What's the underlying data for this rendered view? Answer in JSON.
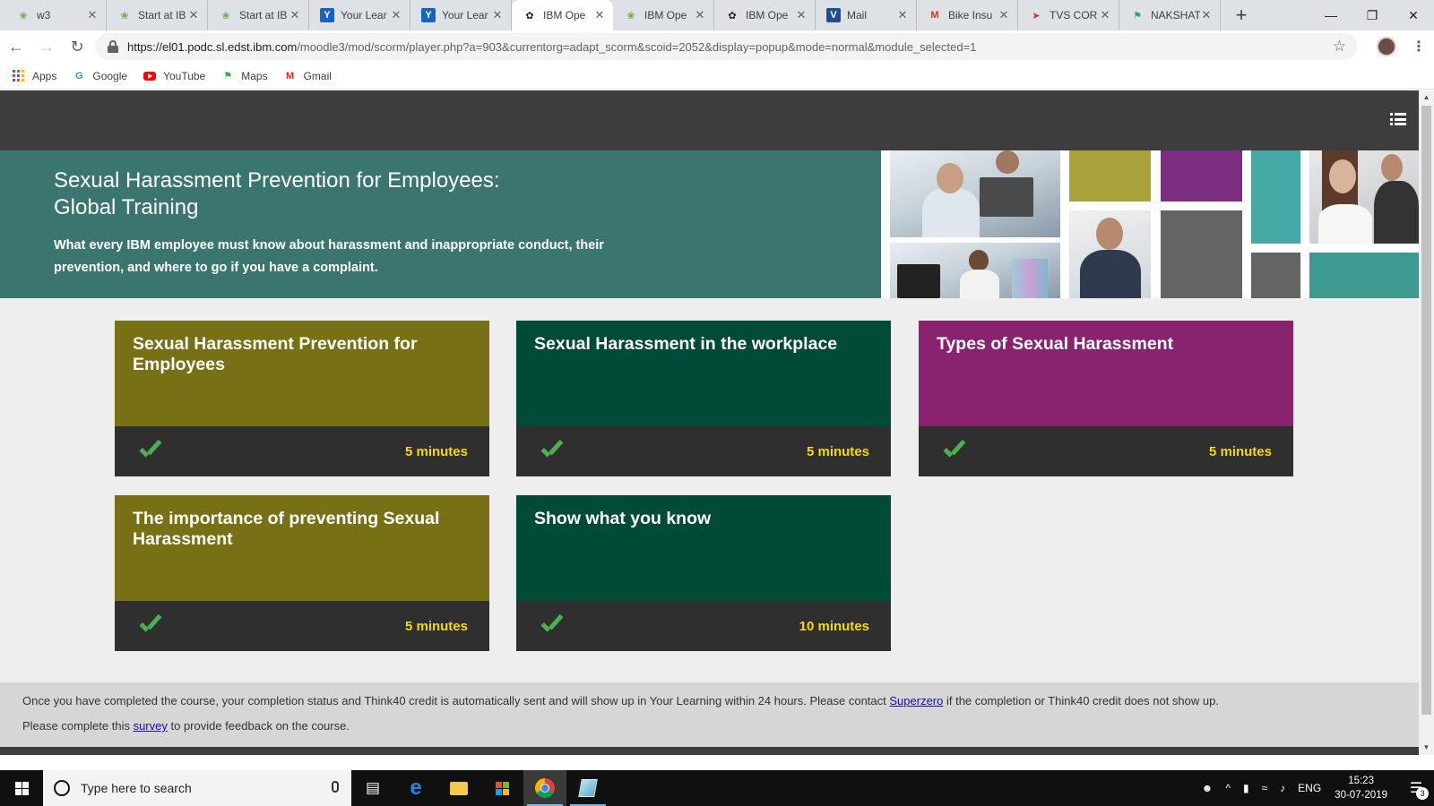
{
  "browser": {
    "tabs": [
      {
        "title": "w3",
        "icon": "ibm-bee-icon",
        "active": false
      },
      {
        "title": "Start at IB",
        "icon": "ibm-bee-icon",
        "active": false
      },
      {
        "title": "Start at IB",
        "icon": "ibm-bee-icon",
        "active": false
      },
      {
        "title": "Your Lear",
        "icon": "yl-icon",
        "active": false
      },
      {
        "title": "Your Lear",
        "icon": "yl-icon",
        "active": false
      },
      {
        "title": "IBM Ope",
        "icon": "ibm-icon",
        "active": true
      },
      {
        "title": "IBM Ope",
        "icon": "ibm-bee-icon",
        "active": false
      },
      {
        "title": "IBM Ope",
        "icon": "ibm-icon",
        "active": false
      },
      {
        "title": "Mail",
        "icon": "verse-icon",
        "active": false
      },
      {
        "title": "Bike Insu",
        "icon": "gmail-icon",
        "active": false
      },
      {
        "title": "TVS COR",
        "icon": "tvs-icon",
        "active": false
      },
      {
        "title": "NAKSHAT",
        "icon": "maps-icon",
        "active": false
      }
    ],
    "new_tab": "+",
    "close_glyph": "✕",
    "window_controls": {
      "minimize": "—",
      "restore": "❐",
      "close": "✕"
    },
    "url_host": "https://el01.podc.sl.edst.ibm.com",
    "url_path": "/moodle3/mod/scorm/player.php?a=903&currentorg=adapt_scorm&scoid=2052&display=popup&mode=normal&module_selected=1",
    "bookmarks": [
      {
        "label": "Apps",
        "icon": "apps-grid-icon"
      },
      {
        "label": "Google",
        "icon": "google-icon"
      },
      {
        "label": "YouTube",
        "icon": "youtube-icon"
      },
      {
        "label": "Maps",
        "icon": "maps-icon"
      },
      {
        "label": "Gmail",
        "icon": "gmail-icon"
      }
    ]
  },
  "course": {
    "title_line1": "Sexual Harassment Prevention for Employees:",
    "title_line2": "Global Training",
    "description": "What every IBM employee must know about harassment and inappropriate conduct, their prevention, and where to go if you have a complaint.",
    "modules": [
      {
        "title": "Sexual Harassment Prevention for Employees",
        "duration": "5 minutes",
        "completed": true,
        "color": "#777014"
      },
      {
        "title": "Sexual Harassment in the workplace",
        "duration": "5 minutes",
        "completed": true,
        "color": "#004b37"
      },
      {
        "title": "Types of Sexual Harassment",
        "duration": "5 minutes",
        "completed": true,
        "color": "#8a236f"
      },
      {
        "title": "The importance of preventing Sexual Harassment",
        "duration": "5 minutes",
        "completed": true,
        "color": "#777014"
      },
      {
        "title": "Show what you know",
        "duration": "10 minutes",
        "completed": true,
        "color": "#004b37"
      }
    ]
  },
  "footer": {
    "line1_before": "Once you have completed the course, your completion status and Think40 credit is automatically sent and will show up in Your Learning within 24 hours. Please contact ",
    "line1_link": "Superzero",
    "line1_after": " if the completion or Think40 credit does not show up.",
    "line2_before": "Please complete this ",
    "line2_link": "survey",
    "line2_after": " to provide feedback on the course."
  },
  "taskbar": {
    "search_placeholder": "Type here to search",
    "language": "ENG",
    "time": "15:23",
    "date": "30-07-2019",
    "notification_count": "3"
  },
  "colors": {
    "header_bar": "#3d3d3d",
    "hero_bg": "#3b756f",
    "olive": "#777014",
    "dark_green": "#004b37",
    "purple": "#8a236f",
    "duration_text": "#f5d90a",
    "check": "#4caf50"
  }
}
